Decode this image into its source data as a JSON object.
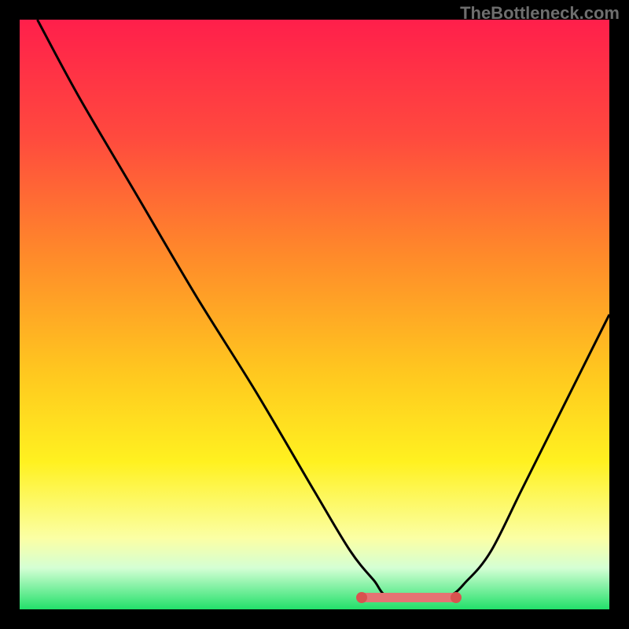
{
  "watermark": "TheBottleneck.com",
  "chart_data": {
    "type": "line",
    "title": "",
    "xlabel": "",
    "ylabel": "",
    "xlim": [
      0,
      100
    ],
    "ylim": [
      0,
      100
    ],
    "grid": false,
    "series": [
      {
        "name": "curve",
        "x": [
          3,
          10,
          20,
          30,
          40,
          50,
          56,
          60,
          63,
          72,
          76,
          80,
          85,
          90,
          95,
          100
        ],
        "y": [
          100,
          87,
          70,
          53,
          37,
          20,
          10,
          5,
          2,
          2,
          5,
          10,
          20,
          30,
          40,
          50
        ]
      }
    ],
    "flat_segment": {
      "x_start": 58,
      "x_end": 74,
      "y": 2
    },
    "markers": [
      {
        "x": 58,
        "y": 2
      },
      {
        "x": 74,
        "y": 2
      }
    ],
    "gradient_stops": [
      {
        "offset": 0,
        "color": "#ff1f4b"
      },
      {
        "offset": 20,
        "color": "#ff4a3e"
      },
      {
        "offset": 40,
        "color": "#ff8a2a"
      },
      {
        "offset": 60,
        "color": "#ffc81f"
      },
      {
        "offset": 75,
        "color": "#fff120"
      },
      {
        "offset": 88,
        "color": "#fbffa5"
      },
      {
        "offset": 93,
        "color": "#d4ffd4"
      },
      {
        "offset": 100,
        "color": "#22e06a"
      }
    ],
    "colors": {
      "line": "#000000",
      "flat_line": "#e57373",
      "dot": "#d9534f",
      "background": "#000000"
    }
  }
}
